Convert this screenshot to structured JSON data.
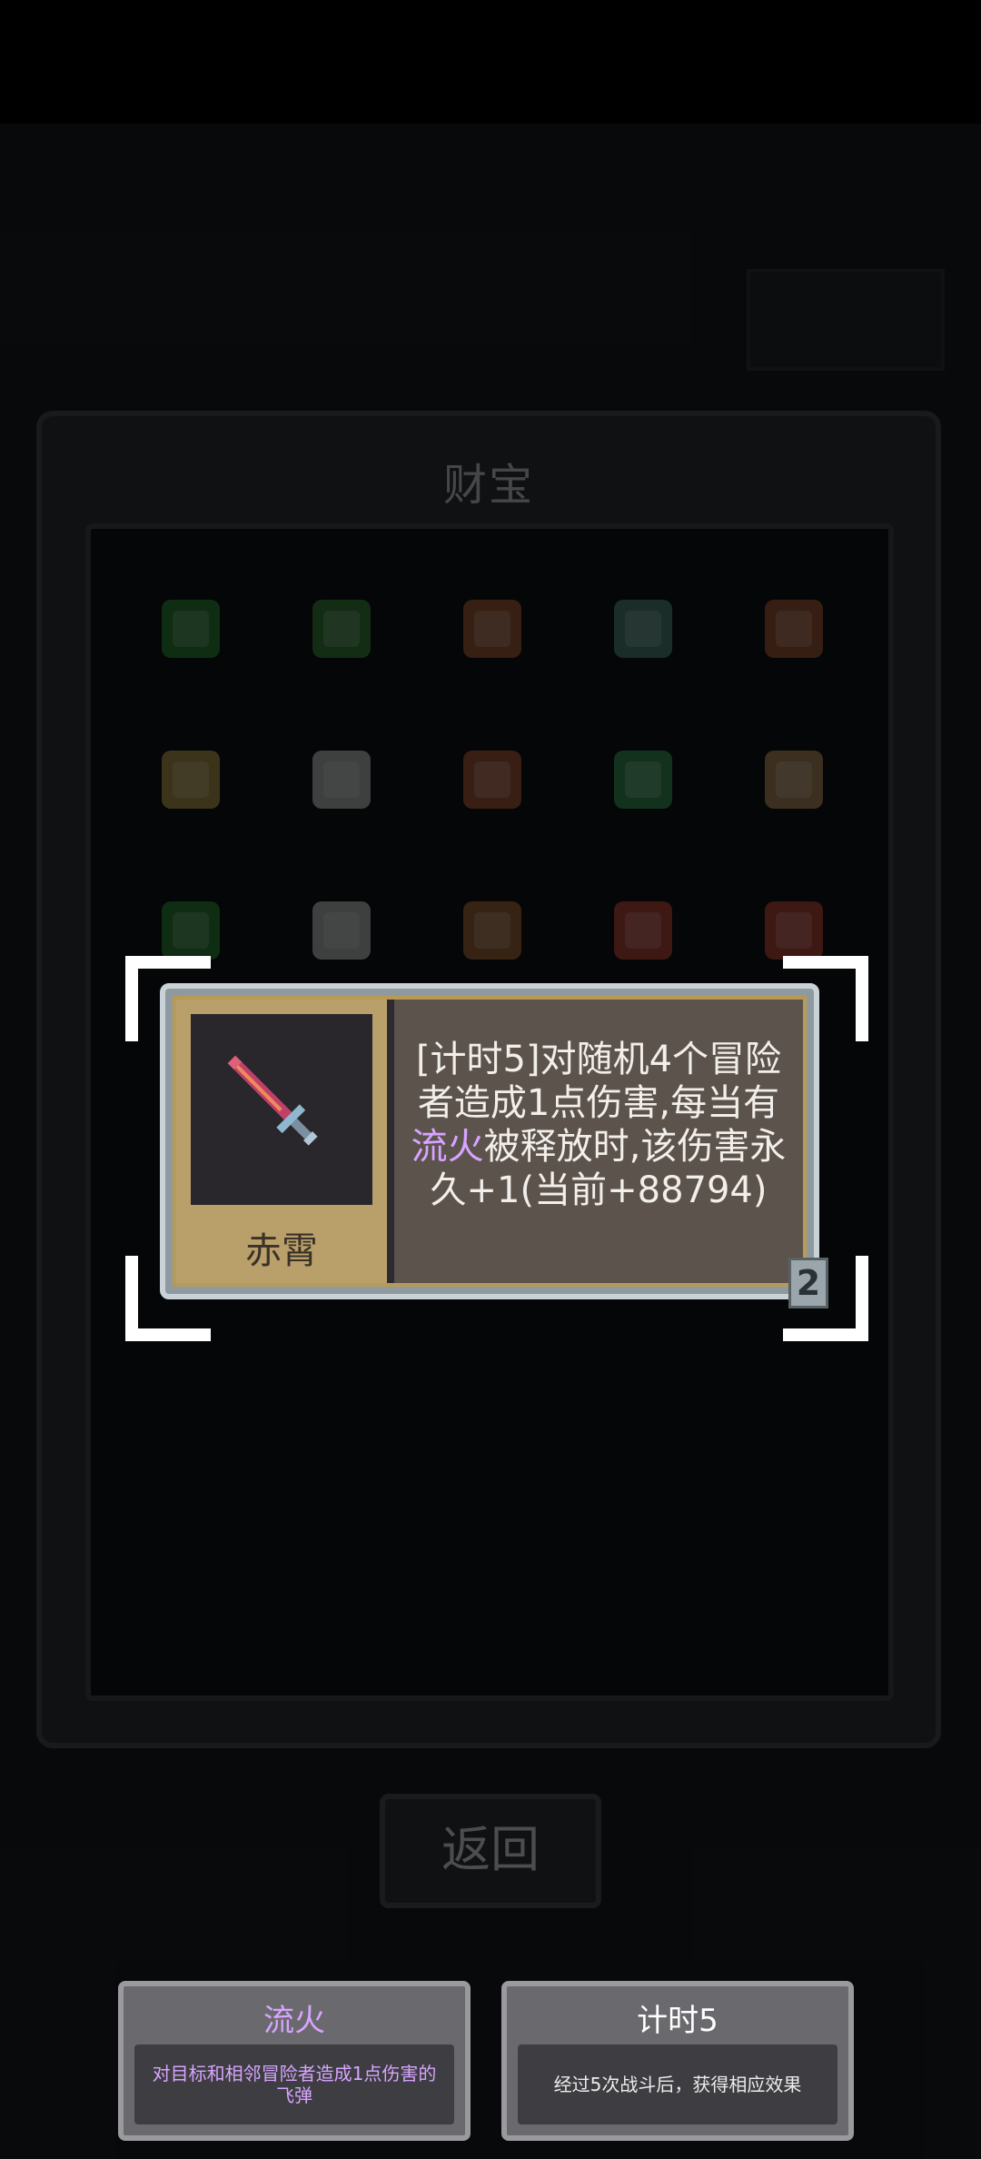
{
  "panel": {
    "title": "财宝",
    "return_label": "返回"
  },
  "treasures": [
    {
      "icon": "gem-icon",
      "color": "#2e8a3a"
    },
    {
      "icon": "hat-icon",
      "color": "#3a8a3e"
    },
    {
      "icon": "shield-icon",
      "color": "#a8603a"
    },
    {
      "icon": "scroll-icon",
      "color": "#4f8a7a"
    },
    {
      "icon": "sword-icon",
      "color": "#a85a3a"
    },
    {
      "icon": "potion-icon",
      "color": "#b8a050"
    },
    {
      "icon": "candle-icon",
      "color": "#c0c0c0"
    },
    {
      "icon": "horn-icon",
      "color": "#b05a3a"
    },
    {
      "icon": "table-icon",
      "color": "#3a9a5a"
    },
    {
      "icon": "bunny-icon",
      "color": "#b89060"
    },
    {
      "icon": "leaf-icon",
      "color": "#2e8a3a"
    },
    {
      "icon": "bottle-icon",
      "color": "#c0c0c0"
    },
    {
      "icon": "hand-icon",
      "color": "#a86a3a"
    },
    {
      "icon": "bag-icon",
      "color": "#c04a3a"
    },
    {
      "icon": "pot-icon",
      "color": "#c04a3a"
    }
  ],
  "popup": {
    "item_name": "赤霄",
    "desc_a": "[计时5]对随机4个冒险者造成1点伤害,每当有",
    "desc_keyword": "流火",
    "desc_b": "被释放时,该伤害永久+1(当前+88794)",
    "level": "2",
    "keyword_color": "#d7a4ff"
  },
  "keywords": [
    {
      "title": "流火",
      "title_color": "#d7a4ff",
      "body": "对目标和相邻冒险者造成1点伤害的飞弹",
      "body_color": "#d7a4ff"
    },
    {
      "title": "计时5",
      "title_color": "#ffffff",
      "body": "经过5次战斗后，获得相应效果",
      "body_color": "#ececec"
    }
  ]
}
